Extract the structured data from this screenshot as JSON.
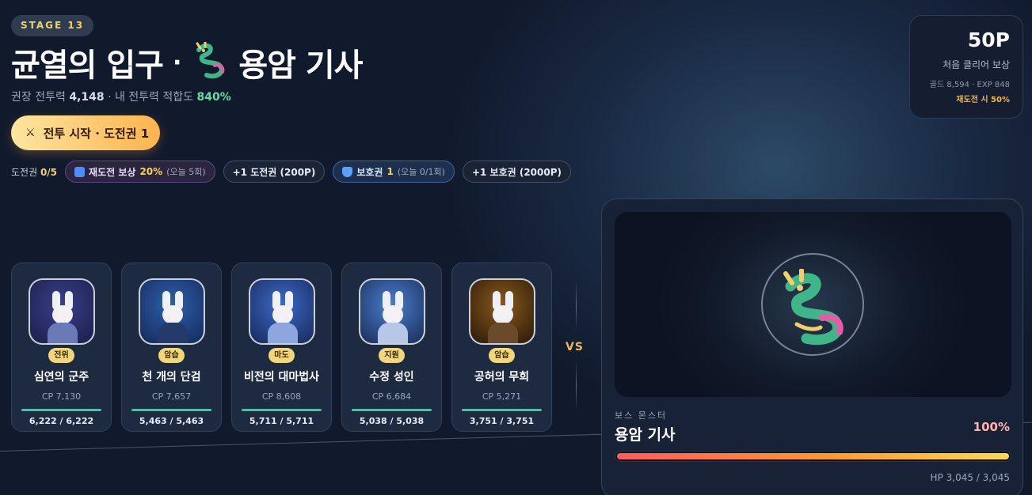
{
  "stage": {
    "badge": "STAGE 13"
  },
  "header": {
    "title_part1": "균열의 입구",
    "separator": "·",
    "title_part2": "용암 기사",
    "sub_prefix": "권장 전투력",
    "recommended_cp": "4,148",
    "sub_mid": "· 내 전투력 적합도",
    "fitness": "840%"
  },
  "start_button": {
    "label": "전투 시작 · 도전권 1"
  },
  "tickets": {
    "label": "도전권",
    "count": "0/5",
    "retry_reward_label": "재도전 보상",
    "retry_reward_value": "20%",
    "retry_today": "(오늘 5회)",
    "buy_ticket": "+1 도전권 (200P)",
    "shield_label": "보호권",
    "shield_value": "1",
    "shield_today": "(오늘 0/1회)",
    "buy_shield": "+1 보호권 (2000P)"
  },
  "reward": {
    "points": "50P",
    "label": "처음 클리어 보상",
    "detail": "골드 8,594 · EXP 848",
    "retry_note": "재도전 시 50%"
  },
  "party": [
    {
      "role": "전위",
      "name": "심연의 군주",
      "cp": "CP 7,130",
      "hp": "6,222 / 6,222",
      "hp_ratio": 1.0,
      "bg": [
        "#3b3f8a",
        "#1a1f4a"
      ],
      "armor": "#6a7ab8"
    },
    {
      "role": "암습",
      "name": "천 개의 단검",
      "cp": "CP 7,657",
      "hp": "5,463 / 5,463",
      "hp_ratio": 1.0,
      "bg": [
        "#2f5fae",
        "#142a5a"
      ],
      "armor": "#233a6a"
    },
    {
      "role": "마도",
      "name": "비전의 대마법사",
      "cp": "CP 8,608",
      "hp": "5,711 / 5,711",
      "hp_ratio": 1.0,
      "bg": [
        "#3c6bc8",
        "#17285a"
      ],
      "armor": "#8ea6e0"
    },
    {
      "role": "지원",
      "name": "수정 성인",
      "cp": "CP 6,684",
      "hp": "5,038 / 5,038",
      "hp_ratio": 1.0,
      "bg": [
        "#4a7fd0",
        "#1a2c56"
      ],
      "armor": "#b8c6e8"
    },
    {
      "role": "암습",
      "name": "공허의 무희",
      "cp": "CP 5,271",
      "hp": "3,751 / 3,751",
      "hp_ratio": 1.0,
      "bg": [
        "#8a5a1e",
        "#2a1808"
      ],
      "armor": "#6a4a2a"
    }
  ],
  "vs": "VS",
  "boss": {
    "label": "보스 몬스터",
    "name": "용암 기사",
    "percent": "100%",
    "hp_ratio": 1.0,
    "hp": "HP 3,045 / 3,045"
  },
  "colors": {
    "gold": "#f2cf6a",
    "hp_green": "#27d4a4",
    "accent_orange": "#ffb44d"
  }
}
